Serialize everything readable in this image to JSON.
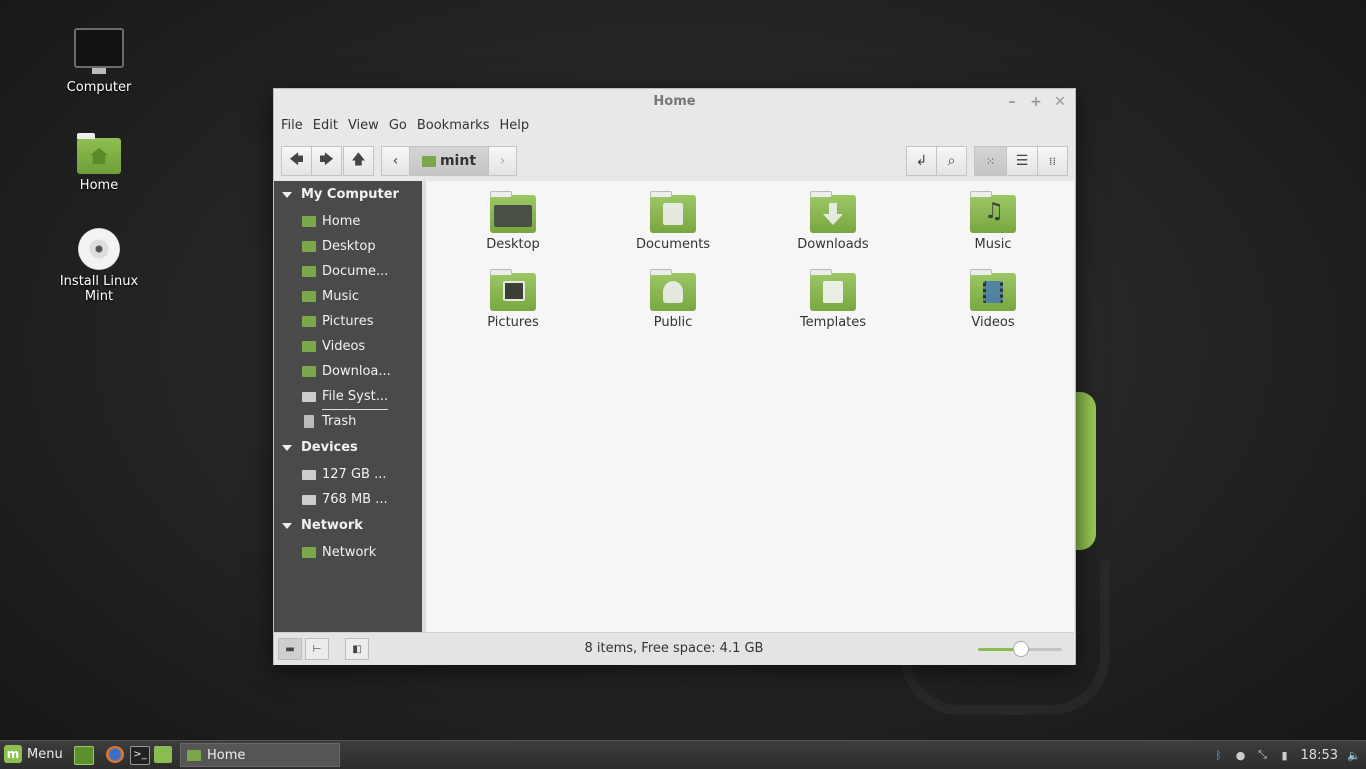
{
  "desktop": {
    "icons": [
      {
        "label": "Computer"
      },
      {
        "label": "Home"
      },
      {
        "label": "Install Linux Mint"
      }
    ]
  },
  "window": {
    "title": "Home",
    "controls": {
      "minimize": "–",
      "maximize": "+",
      "close": "✕"
    },
    "menu": [
      "File",
      "Edit",
      "View",
      "Go",
      "Bookmarks",
      "Help"
    ],
    "path": {
      "current": "mint"
    },
    "sidebar": {
      "sections": [
        {
          "title": "My Computer",
          "items": [
            "Home",
            "Desktop",
            "Docume...",
            "Music",
            "Pictures",
            "Videos",
            "Downloa...",
            "File Syst...",
            "Trash"
          ]
        },
        {
          "title": "Devices",
          "items": [
            "127 GB ...",
            "768 MB ..."
          ]
        },
        {
          "title": "Network",
          "items": [
            "Network"
          ]
        }
      ]
    },
    "files": [
      "Desktop",
      "Documents",
      "Downloads",
      "Music",
      "Pictures",
      "Public",
      "Templates",
      "Videos"
    ],
    "status": {
      "text": "8 items, Free space: 4.1 GB",
      "zoom_fraction": 0.5
    }
  },
  "taskbar": {
    "menu_label": "Menu",
    "window_button": "Home",
    "clock": "18:53"
  },
  "colors": {
    "accent": "#8cc152",
    "sidebar": "#4a4a4a",
    "folder": "#7ba74a"
  }
}
